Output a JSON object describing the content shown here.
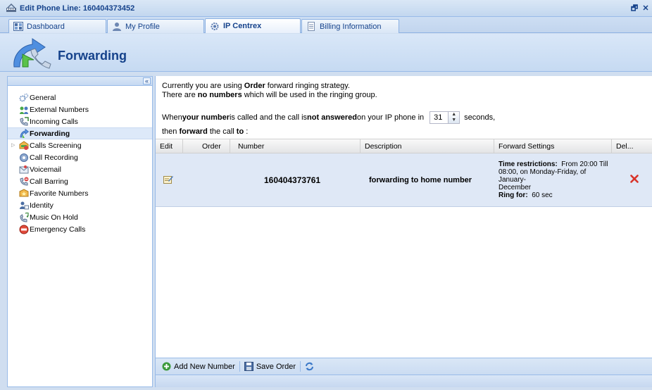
{
  "window": {
    "title": "Edit Phone Line: 160404373452",
    "restore_glyph": "🗗",
    "close_glyph": "✕"
  },
  "tabs": [
    {
      "label": "Dashboard",
      "icon": "dashboard-icon",
      "active": false
    },
    {
      "label": "My Profile",
      "icon": "user-icon",
      "active": false
    },
    {
      "label": "IP Centrex",
      "icon": "gear-icon",
      "active": true
    },
    {
      "label": "Billing Information",
      "icon": "document-icon",
      "active": false
    }
  ],
  "header": {
    "title": "Forwarding"
  },
  "sidebar": {
    "collapse_glyph": "«",
    "items": [
      {
        "label": "General",
        "icon": "gears-icon"
      },
      {
        "label": "External Numbers",
        "icon": "external-numbers-icon"
      },
      {
        "label": "Incoming Calls",
        "icon": "incoming-calls-icon"
      },
      {
        "label": "Forwarding",
        "icon": "forwarding-icon",
        "selected": true
      },
      {
        "label": "Calls Screening",
        "icon": "calls-screening-icon",
        "expandable": true
      },
      {
        "label": "Call Recording",
        "icon": "call-recording-icon"
      },
      {
        "label": "Voicemail",
        "icon": "voicemail-icon"
      },
      {
        "label": "Call Barring",
        "icon": "call-barring-icon"
      },
      {
        "label": "Favorite Numbers",
        "icon": "favorite-numbers-icon"
      },
      {
        "label": "Identity",
        "icon": "identity-icon"
      },
      {
        "label": "Music On Hold",
        "icon": "music-icon"
      },
      {
        "label": "Emergency Calls",
        "icon": "emergency-icon"
      }
    ]
  },
  "info": {
    "l1_a": "Currently you are using ",
    "l1_b": "Order",
    "l1_c": " forward ringing strategy.",
    "l2_a": "There are ",
    "l2_b": "no numbers",
    "l2_c": " which will be used in the ringing group.",
    "l3_a": "When ",
    "l3_b": "your number",
    "l3_c": " is called and the call is ",
    "l3_d": "not answered",
    "l3_e": " on your IP phone in",
    "timeout_value": "31",
    "l3_f": "seconds,",
    "l4_a": "then ",
    "l4_b": "forward",
    "l4_c": " the call ",
    "l4_d": "to",
    "l4_e": " :"
  },
  "grid": {
    "columns": [
      "Edit",
      "Order",
      "Number",
      "Description",
      "Forward Settings",
      "Del..."
    ],
    "rows": [
      {
        "order": "",
        "number": "160404373761",
        "description": "forwarding to home number",
        "time_label": "Time restrictions:",
        "time_text_1": "From 20:00 Till",
        "time_text_2": "08:00, on Monday-Friday, of January-",
        "time_text_3": "December",
        "ring_label": "Ring for:",
        "ring_value": "60 sec"
      }
    ]
  },
  "toolbar": {
    "add_label": "Add New Number",
    "save_label": "Save Order"
  }
}
